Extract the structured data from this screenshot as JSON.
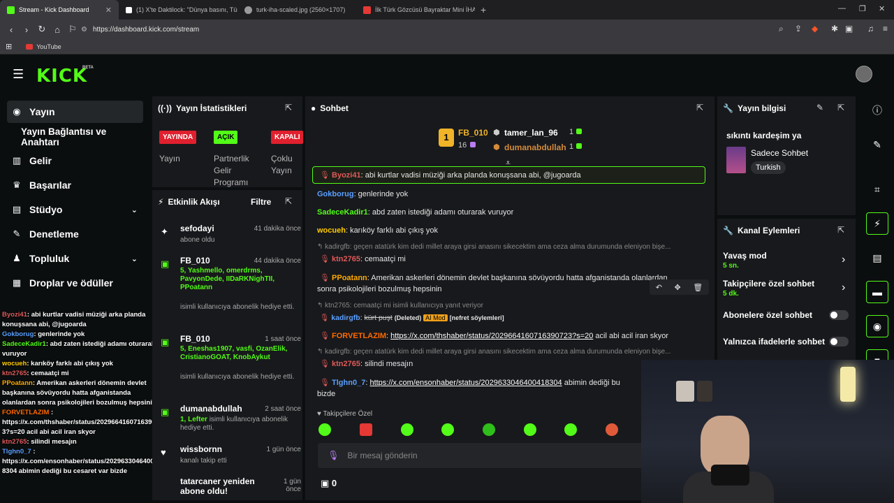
{
  "browser": {
    "tabs": [
      {
        "title": "Stream - Kick Dashboard",
        "fav_color": "#53fc18"
      },
      {
        "title": "(1) X'te Daktilock: \"Dünya basını, Türk...",
        "fav_color": "#ffffff"
      },
      {
        "title": "turk-iha-scaled.jpg (2560×1707)",
        "fav_color": "#9a9a9a"
      },
      {
        "title": "İlk Türk Gözcüsü Bayraktar Mini İHA...",
        "fav_color": "#e53935"
      }
    ],
    "url": "https://dashboard.kick.com/stream",
    "bookmark": "YouTube"
  },
  "kick": {
    "logo": "KICK",
    "beta": "BETA"
  },
  "sidebar": {
    "items": [
      {
        "label": "Yayın",
        "icon": "broadcast-icon"
      },
      {
        "label": "Yayın Bağlantısı ve Anahtarı",
        "icon": ""
      },
      {
        "label": "Gelir",
        "icon": "chart-icon"
      },
      {
        "label": "Başarılar",
        "icon": "trophy-icon"
      },
      {
        "label": "Stüdyo",
        "icon": "studio-icon"
      },
      {
        "label": "Denetleme",
        "icon": "wrench-icon"
      },
      {
        "label": "Topluluk",
        "icon": "community-icon"
      },
      {
        "label": "Droplar ve ödüller",
        "icon": "drops-icon"
      }
    ]
  },
  "overlay_chat": [
    {
      "user": "Byozi41",
      "text": ": abi kurtlar vadisi müziği arka planda",
      "cont": "konuşsana abi, @jugoarda",
      "color": "#e05a5a"
    },
    {
      "user": "Gokborug",
      "text": ": genlerinde yok",
      "color": "#5aa0ff"
    },
    {
      "user": "SadeceKadir1",
      "text": ": abd zaten istediği adamı oturarak",
      "cont": "vuruyor",
      "color": "#53fc18"
    },
    {
      "user": "wocueh",
      "text": ": karıköy farklı abi çıkış yok",
      "color": "#ffcc00"
    },
    {
      "user": "ktn2765",
      "text": ": cemaatçi mi",
      "color": "#e05a5a"
    },
    {
      "user": "PPoatann",
      "text": ": Amerikan askerleri dönemin devlet",
      "cont": "başkanına sövüyordu hatta afganistanda olanlardan sonra psikolojileri bozulmuş hepsinin",
      "color": "#ffaa00"
    },
    {
      "user": "FORVETLAZIM",
      "text": " :",
      "cont": "https://x.com/thshaber/status/2029664160716390723?s=20 acil abi acil iran skyor",
      "color": "#ff6a00"
    },
    {
      "user": "ktn2765",
      "text": ": silindi mesajın",
      "color": "#e05a5a"
    },
    {
      "user": "Tlghn0_7",
      "text": " :",
      "cont": "https://x.com/ensonhaber/status/2029633046400418304 abimin dediği bu cesaret var bizde",
      "color": "#5aa0ff"
    }
  ],
  "stats": {
    "title": "Yayın İstatistikleri",
    "badges": [
      {
        "text": "YAYINDA",
        "label": "Yayın"
      },
      {
        "text": "AÇIK",
        "label": "Partnerlik Gelir Programı"
      },
      {
        "text": "KAPALI",
        "label": "Çoklu Yayın"
      }
    ]
  },
  "activity": {
    "title": "Etkinlik Akışı",
    "filter": "Filtre",
    "items": [
      {
        "user": "sefodayi",
        "time": "41 dakika önce",
        "body": "abone oldu",
        "highlight": ""
      },
      {
        "user": "FB_010",
        "time": "44 dakika önce",
        "highlight": "5, Yashmello, omerdrms, PavyonDede, IIDaRKNighTII, PPoatann",
        "body": "isimli kullanıcıya abonelik hediye etti."
      },
      {
        "user": "FB_010",
        "time": "1 saat önce",
        "highlight": "5, Eneshas1907, vasfi, OzanElik, CristianoGOAT, KnobAykut",
        "body": "isimli kullanıcıya abonelik hediye etti."
      },
      {
        "user": "dumanabdullah",
        "time": "2 saat önce",
        "highlight": "1, Lefter",
        "body": "isimli kullanıcıya abonelik hediye etti."
      },
      {
        "user": "wissbornn",
        "time": "1 gün önce",
        "body": "kanalı takip etti",
        "highlight": ""
      },
      {
        "user": "tatarcaner yeniden abone oldu!",
        "time": "1 gün önce",
        "body": "",
        "highlight": ""
      }
    ]
  },
  "chat": {
    "title": "Sohbet",
    "leaderboard": {
      "top": {
        "rank": "1",
        "user": "FB_010",
        "count": "16"
      },
      "list": [
        {
          "user": "tamer_lan_96",
          "count": "1"
        },
        {
          "user": "dumanabdullah",
          "count": "1"
        }
      ]
    },
    "pinned": {
      "user": "Byozi41",
      "text": ": abi kurtlar vadisi müziği arka planda konuşsana abi, @jugoarda"
    },
    "messages": [
      {
        "user": "Gokborug",
        "text": ": genlerinde yok",
        "color": "#5aa0ff"
      },
      {
        "user": "SadeceKadir1",
        "text": ": abd zaten istediği adamı oturarak vuruyor",
        "color": "#53fc18"
      },
      {
        "user": "wocueh",
        "text": ": karıköy farklı abi çıkış yok",
        "color": "#ffcc00"
      }
    ],
    "reply1": "kadirgfb: geçen atatürk kim dedi millet araya girsi anasını sikecektim ama ceza alma durumunda eleniyon bişe...",
    "msg_ktn1": {
      "user": "ktn2765",
      "text": ": cemaatçi mi"
    },
    "msg_ppoatann": {
      "user": "PPoatann",
      "text": ": Amerikan askerleri dönemin devlet başkanına sövüyordu hatta afganistanda olanlardan",
      "cont": "sonra psikolojileri bozulmuş hepsinin"
    },
    "reply2": "ktn2765: cemaatçi mi isimli kullanıcıya yanıt veriyor",
    "msg_kadir": {
      "user": "kadirgfb",
      "deleted": "kürt puşt",
      "deleted_tag": "(Deleted)",
      "ai": "AI Mod",
      "reason": "[nefret söylemleri]"
    },
    "msg_forvet": {
      "user": "FORVETLAZIM",
      "link": "https://x.com/thshaber/status/2029664160716390723?s=20",
      "text": " acil abi acil iran skyor"
    },
    "reply3": "kadirgfb: geçen atatürk kim dedi millet araya girsi anasını sikecektim ama ceza alma durumunda eleniyon bişe...",
    "msg_ktn2": {
      "user": "ktn2765",
      "text": ": silindi mesajın"
    },
    "msg_tlghn": {
      "user": "Tlghn0_7",
      "link": "https://x.com/ensonhaber/status/2029633046400418304",
      "text": " abimin dediği bu",
      "cont": "bizde"
    },
    "followers_only": "Takipçilere Özel",
    "input_placeholder": "Bir mesaj gönderin",
    "points": "0"
  },
  "stream_info": {
    "title": "Yayın bilgisi",
    "stream_title": "sıkıntı kardeşim ya",
    "category": "Sadece Sohbet",
    "language": "Turkish"
  },
  "channel_actions": {
    "title": "Kanal Eylemleri",
    "slow_mode": {
      "label": "Yavaş mod",
      "value": "5 sn."
    },
    "followers_chat": {
      "label": "Takipçilere özel sohbet",
      "value": "5 dk."
    },
    "subs_only": "Abonelere özel sohbet",
    "emotes_only": "Yalnızca ifadelerle sohbet"
  },
  "colors": {
    "accent": "#53fc18",
    "live_red": "#e0202e",
    "panel": "#18191c"
  }
}
